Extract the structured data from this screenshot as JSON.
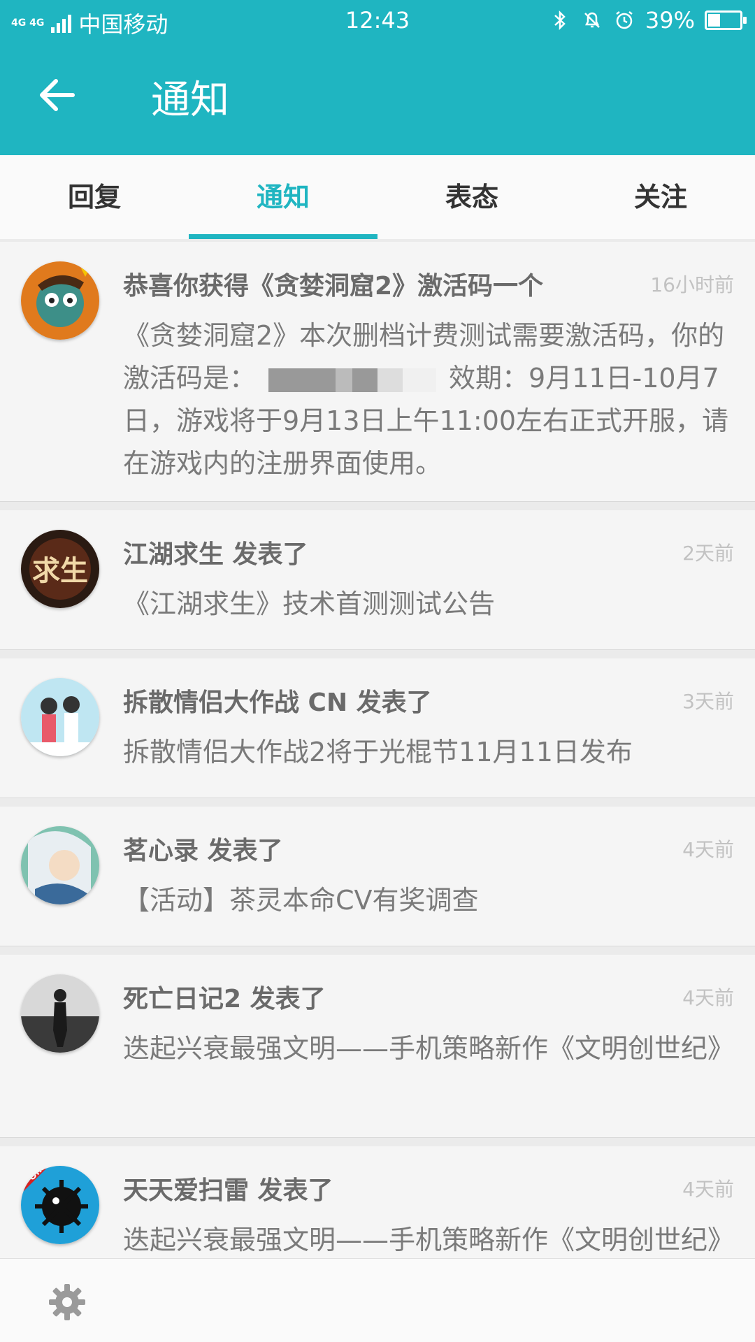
{
  "status_bar": {
    "network": "4G 4G",
    "carrier": "中国移动",
    "time": "12:43",
    "battery": "39%",
    "battery_level": 0.39
  },
  "header": {
    "title": "通知"
  },
  "tabs": [
    {
      "label": "回复",
      "active": false
    },
    {
      "label": "通知",
      "active": true
    },
    {
      "label": "表态",
      "active": false
    },
    {
      "label": "关注",
      "active": false
    }
  ],
  "notifications": [
    {
      "title": "恭喜你获得《贪婪洞窟2》激活码一个",
      "time": "16小时前",
      "body_part1": "《贪婪洞窟2》本次删档计费测试需要激活码，你的激活码是：",
      "body_part2": "效期：9月11日-10月7日，游戏将于9月13日上午11:00左右正式开服，请在游戏内的注册界面使用。",
      "avatar_icon": "cave-game-avatar"
    },
    {
      "title": "江湖求生 发表了",
      "time": "2天前",
      "body": "《江湖求生》技术首测测试公告",
      "avatar_icon": "jianghu-game-avatar",
      "avatar_text": "求生"
    },
    {
      "title": "拆散情侣大作战 CN 发表了",
      "time": "3天前",
      "body": "拆散情侣大作战2将于光棍节11月11日发布",
      "avatar_icon": "couple-game-avatar"
    },
    {
      "title": "茗心录 发表了",
      "time": "4天前",
      "body": "【活动】茶灵本命CV有奖调查",
      "avatar_icon": "mingxinlu-game-avatar"
    },
    {
      "title": "死亡日记2 发表了",
      "time": "4天前",
      "body": "迭起兴衰最强文明——手机策略新作《文明创世纪》",
      "avatar_icon": "death-diary-avatar"
    },
    {
      "title": "天天爱扫雷 发表了",
      "time": "4天前",
      "body": "迭起兴衰最强文明——手机策略新作《文明创世纪》",
      "avatar_icon": "minesweeper-avatar",
      "avatar_text": "Online"
    }
  ],
  "bottom_bar": {
    "settings_icon": "gear-icon"
  },
  "colors": {
    "accent": "#1fb5c1",
    "card_bg": "#f5f5f5",
    "title_text": "#6a6a6a",
    "body_text": "#7a7a7a",
    "time_text": "#c2c2c2"
  }
}
